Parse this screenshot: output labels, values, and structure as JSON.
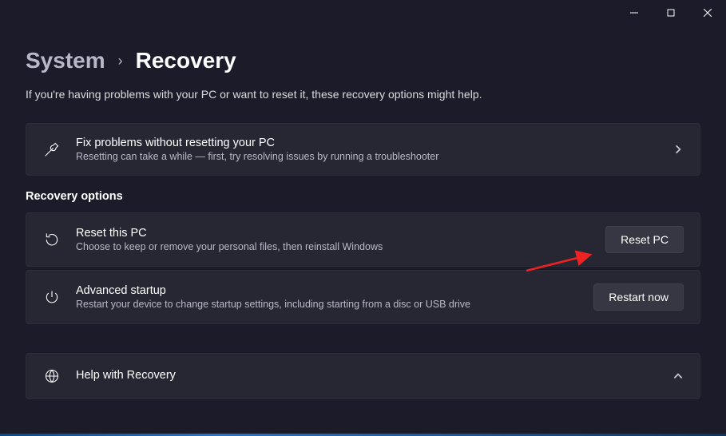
{
  "breadcrumb": {
    "parent": "System",
    "current": "Recovery"
  },
  "description": "If you're having problems with your PC or want to reset it, these recovery options might help.",
  "fixProblems": {
    "title": "Fix problems without resetting your PC",
    "subtitle": "Resetting can take a while — first, try resolving issues by running a troubleshooter"
  },
  "sectionHeader": "Recovery options",
  "resetPC": {
    "title": "Reset this PC",
    "subtitle": "Choose to keep or remove your personal files, then reinstall Windows",
    "button": "Reset PC"
  },
  "advancedStartup": {
    "title": "Advanced startup",
    "subtitle": "Restart your device to change startup settings, including starting from a disc or USB drive",
    "button": "Restart now"
  },
  "help": {
    "title": "Help with Recovery"
  }
}
